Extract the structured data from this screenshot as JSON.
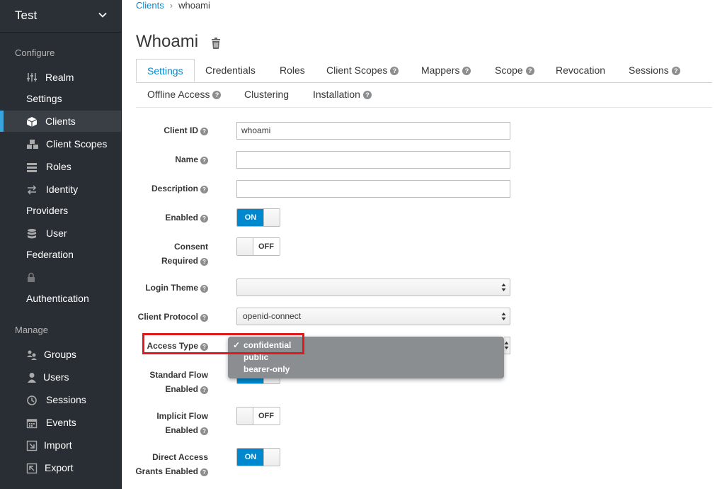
{
  "realm": {
    "name": "Test"
  },
  "sidebar": {
    "configure_title": "Configure",
    "manage_title": "Manage",
    "configure_items": [
      {
        "line1": "Realm",
        "line2": "Settings",
        "icon": "sliders-icon"
      },
      {
        "line1": "Clients",
        "icon": "cube-icon",
        "active": true
      },
      {
        "line1": "Client Scopes",
        "icon": "cubes-icon"
      },
      {
        "line1": "Roles",
        "icon": "list-icon"
      },
      {
        "line1": "Identity",
        "line2": "Providers",
        "icon": "exchange-icon"
      },
      {
        "line1": "User",
        "line2": "Federation",
        "icon": "database-icon"
      },
      {
        "line1": "",
        "line2": "Authentication",
        "icon": "lock-icon"
      }
    ],
    "manage_items": [
      {
        "line1": "Groups",
        "icon": "groups-icon"
      },
      {
        "line1": "Users",
        "icon": "user-icon"
      },
      {
        "line1": "Sessions",
        "icon": "clock-icon"
      },
      {
        "line1": "Events",
        "icon": "calendar-icon"
      },
      {
        "line1": "Import",
        "icon": "import-icon"
      },
      {
        "line1": "Export",
        "icon": "export-icon"
      }
    ]
  },
  "breadcrumb": {
    "link": "Clients",
    "sep": "›",
    "current": "whoami"
  },
  "page": {
    "title": "Whoami"
  },
  "tabs": [
    {
      "label": "Settings",
      "active": true
    },
    {
      "label": "Credentials"
    },
    {
      "label": "Roles"
    },
    {
      "label": "Client Scopes",
      "help": true
    },
    {
      "label": "Mappers",
      "help": true
    },
    {
      "label": "Scope",
      "help": true
    },
    {
      "label": "Revocation"
    },
    {
      "label": "Sessions",
      "help": true
    },
    {
      "label": "Offline Access",
      "help": true
    },
    {
      "label": "Clustering"
    },
    {
      "label": "Installation",
      "help": true
    }
  ],
  "form": {
    "client_id": {
      "label": "Client ID",
      "value": "whoami"
    },
    "name": {
      "label": "Name",
      "value": ""
    },
    "description": {
      "label": "Description",
      "value": ""
    },
    "enabled": {
      "label": "Enabled",
      "state": "ON"
    },
    "consent": {
      "label1": "Consent",
      "label2": "Required",
      "state": "OFF"
    },
    "login_theme": {
      "label": "Login Theme",
      "value": ""
    },
    "client_protocol": {
      "label": "Client Protocol",
      "value": "openid-connect"
    },
    "access_type": {
      "label": "Access Type",
      "options": [
        "confidential",
        "public",
        "bearer-only"
      ],
      "selected": "confidential",
      "check": "✓"
    },
    "standard_flow": {
      "label1": "Standard Flow",
      "label2": "Enabled",
      "state": "ON"
    },
    "implicit_flow": {
      "label1": "Implicit Flow",
      "label2": "Enabled",
      "state": "OFF"
    },
    "direct_access": {
      "label1": "Direct Access",
      "label2": "Grants Enabled",
      "state": "ON"
    }
  },
  "help_glyph": "?",
  "colors": {
    "accent": "#0088ce",
    "sidebar_bg": "#292e34",
    "highlight": "#e1191d"
  }
}
